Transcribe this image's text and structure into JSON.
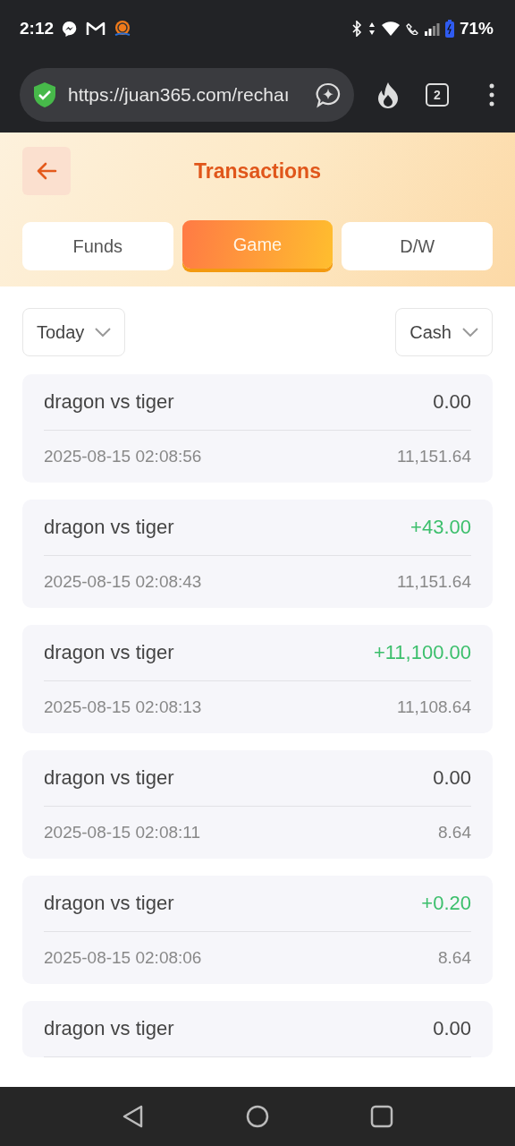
{
  "status_bar": {
    "time": "2:12",
    "battery": "71%"
  },
  "browser": {
    "url": "https://juan365.com/rechaı",
    "tab_count": "2"
  },
  "header": {
    "title": "Transactions"
  },
  "tabs": [
    {
      "label": "Funds",
      "selected": false
    },
    {
      "label": "Game",
      "selected": true
    },
    {
      "label": "D/W",
      "selected": false
    }
  ],
  "filters": [
    {
      "label": "Today"
    },
    {
      "label": "Cash"
    }
  ],
  "records": [
    {
      "title": "dragon vs tiger",
      "amount": "0.00",
      "kind": "zero",
      "date": "2025-08-15 02:08:56",
      "balance": "11,151.64"
    },
    {
      "title": "dragon vs tiger",
      "amount": "+43.00",
      "kind": "win",
      "date": "2025-08-15 02:08:43",
      "balance": "11,151.64"
    },
    {
      "title": "dragon vs tiger",
      "amount": "+11,100.00",
      "kind": "win",
      "date": "2025-08-15 02:08:13",
      "balance": "11,108.64"
    },
    {
      "title": "dragon vs tiger",
      "amount": "0.00",
      "kind": "zero",
      "date": "2025-08-15 02:08:11",
      "balance": "8.64"
    },
    {
      "title": "dragon vs tiger",
      "amount": "+0.20",
      "kind": "win",
      "date": "2025-08-15 02:08:06",
      "balance": "8.64"
    },
    {
      "title": "dragon vs tiger",
      "amount": "0.00",
      "kind": "zero"
    }
  ]
}
